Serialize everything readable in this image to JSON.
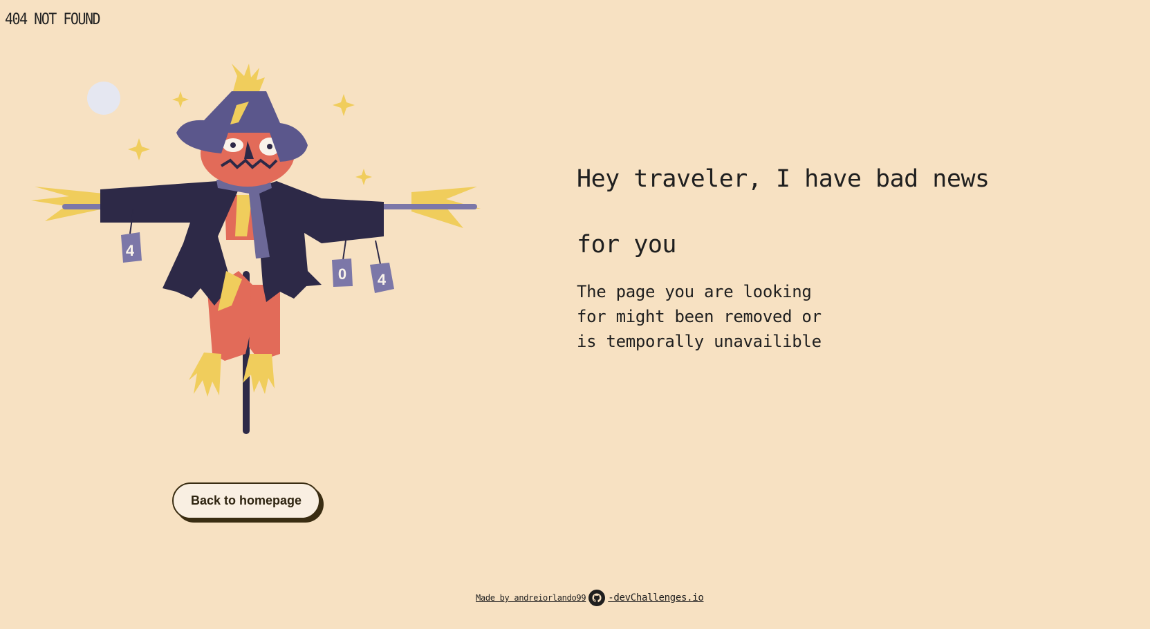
{
  "brand": "404 NOT FOUND",
  "headline": "Hey traveler, I have bad news for you",
  "message": "The page you are looking for might been removed or is temporally unavailible",
  "button": {
    "label": "Back to homepage"
  },
  "footer": {
    "made_by": "Made by andreiorlando99",
    "dev_link": "-devChallenges.io"
  },
  "illustration": {
    "cans": [
      "4",
      "0",
      "4"
    ],
    "icons": [
      "moon-icon",
      "sparkle-icon",
      "scarecrow-illustration",
      "github-icon"
    ]
  },
  "colors": {
    "background": "#f7e1c2",
    "hat": "#5b578c",
    "coat": "#2d2947",
    "face": "#e26b59",
    "straw": "#f0cd5c",
    "scarf": "#6c6898",
    "button_bg": "#f9efe2",
    "button_border": "#3a2d12"
  }
}
